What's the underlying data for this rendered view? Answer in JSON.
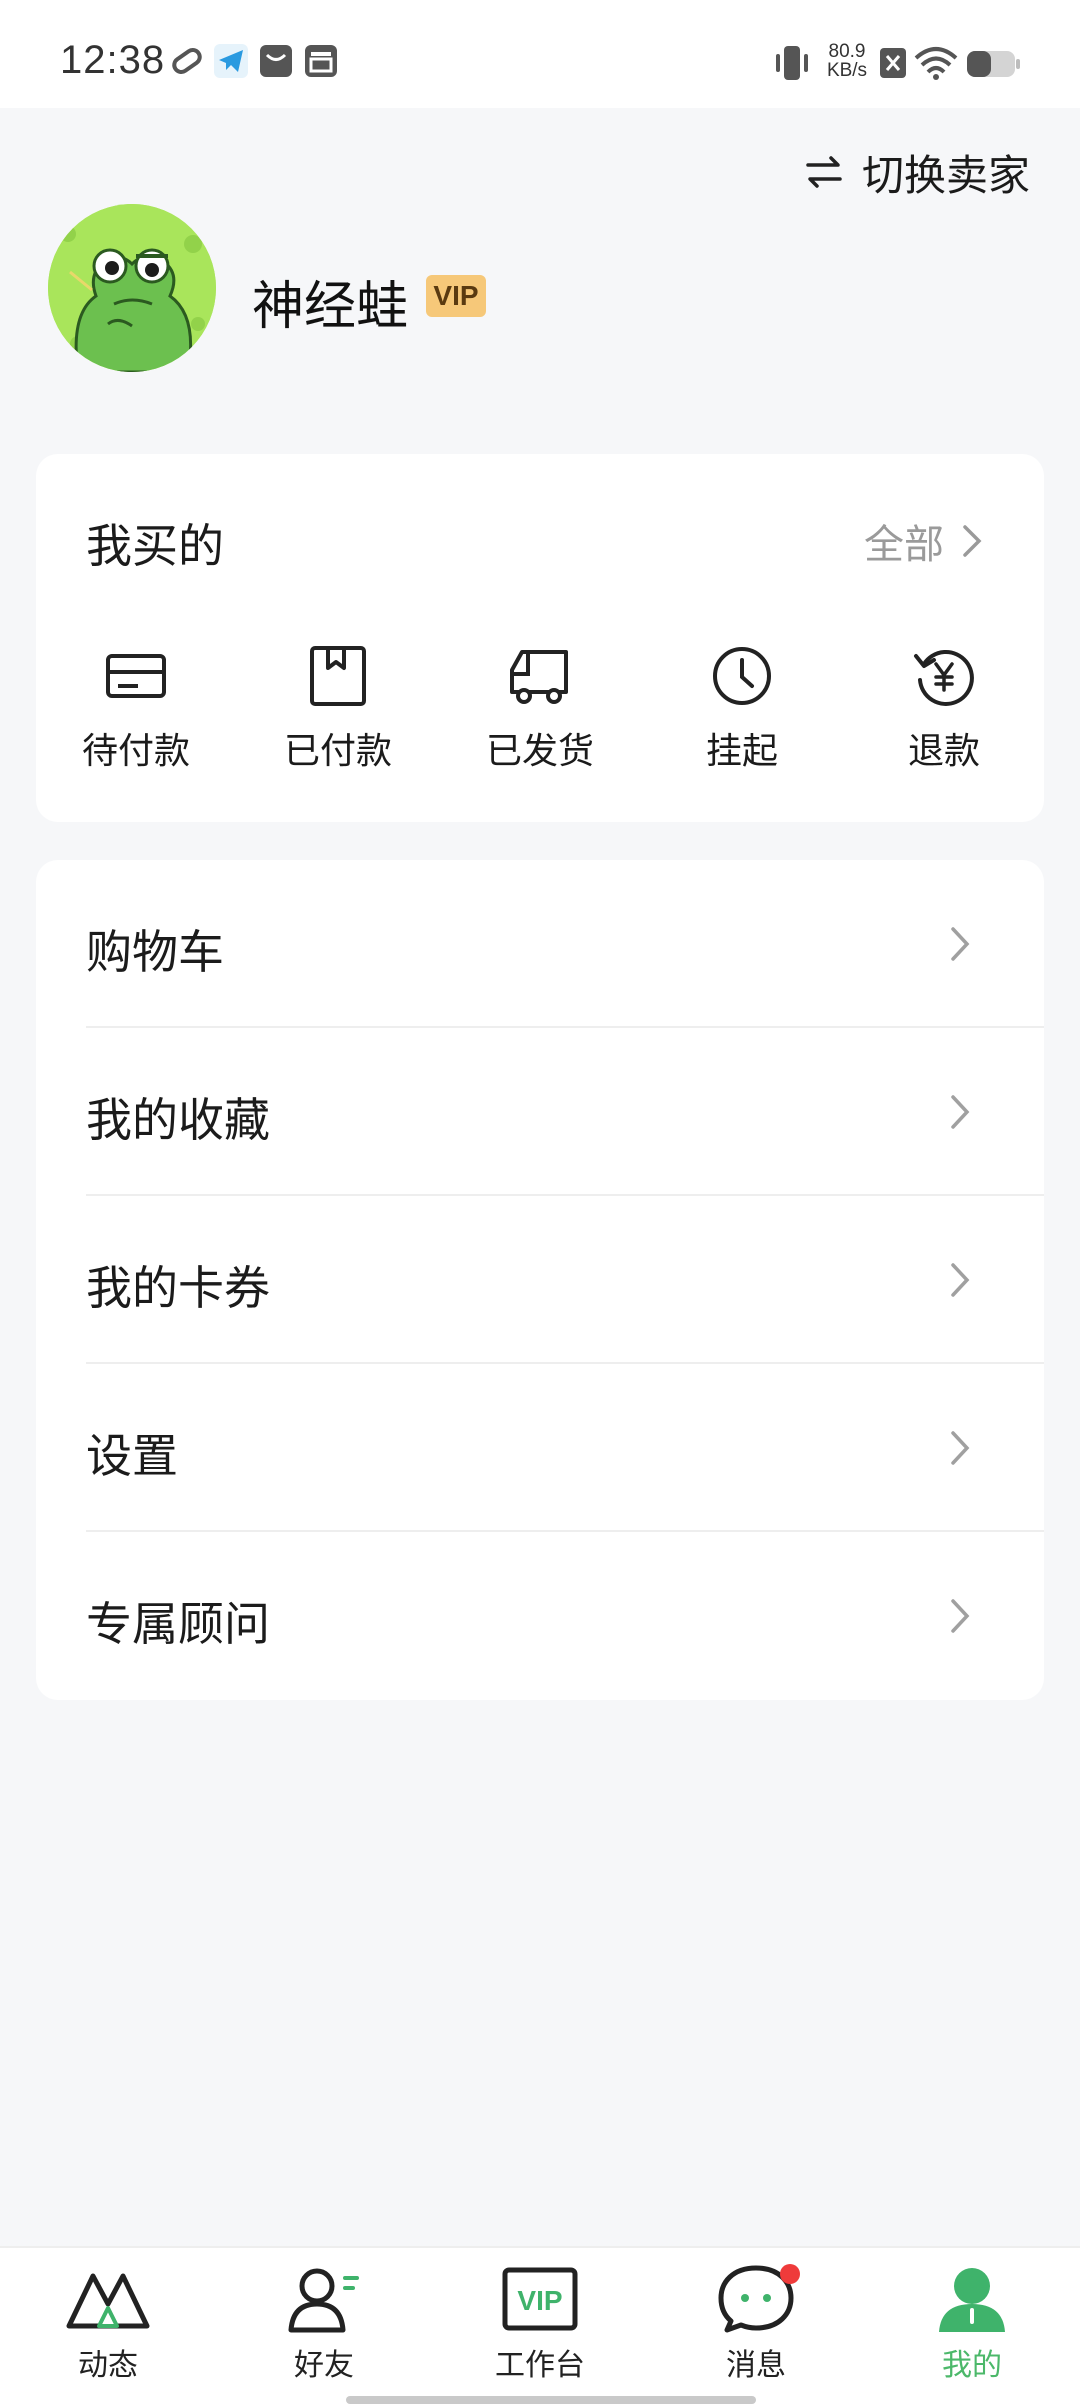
{
  "status_bar": {
    "time": "12:38",
    "net_speed_value": "80.9",
    "net_speed_unit": "KB/s",
    "icons": [
      "link-icon",
      "telegram-icon",
      "message-icon",
      "inbox-icon",
      "vibrate-icon",
      "no-sim-icon",
      "wifi-icon",
      "battery-icon"
    ]
  },
  "header": {
    "switch_label": "切换卖家"
  },
  "profile": {
    "username": "神经蛙",
    "badge": "VIP"
  },
  "orders": {
    "title": "我买的",
    "all_label": "全部",
    "items": [
      {
        "label": "待付款",
        "icon": "card-icon"
      },
      {
        "label": "已付款",
        "icon": "bookmark-icon"
      },
      {
        "label": "已发货",
        "icon": "truck-icon"
      },
      {
        "label": "挂起",
        "icon": "clock-icon"
      },
      {
        "label": "退款",
        "icon": "refund-icon"
      }
    ]
  },
  "menu": {
    "items": [
      {
        "label": "购物车"
      },
      {
        "label": "我的收藏"
      },
      {
        "label": "我的卡券"
      },
      {
        "label": "设置"
      },
      {
        "label": "专属顾问"
      }
    ]
  },
  "bottom_nav": {
    "items": [
      {
        "label": "动态",
        "icon": "mountain-icon"
      },
      {
        "label": "好友",
        "icon": "friends-icon"
      },
      {
        "label": "工作台",
        "icon": "vip-workbench-icon"
      },
      {
        "label": "消息",
        "icon": "chat-icon"
      },
      {
        "label": "我的",
        "icon": "profile-icon",
        "active": true
      }
    ],
    "active_color": "#4cb86a"
  }
}
